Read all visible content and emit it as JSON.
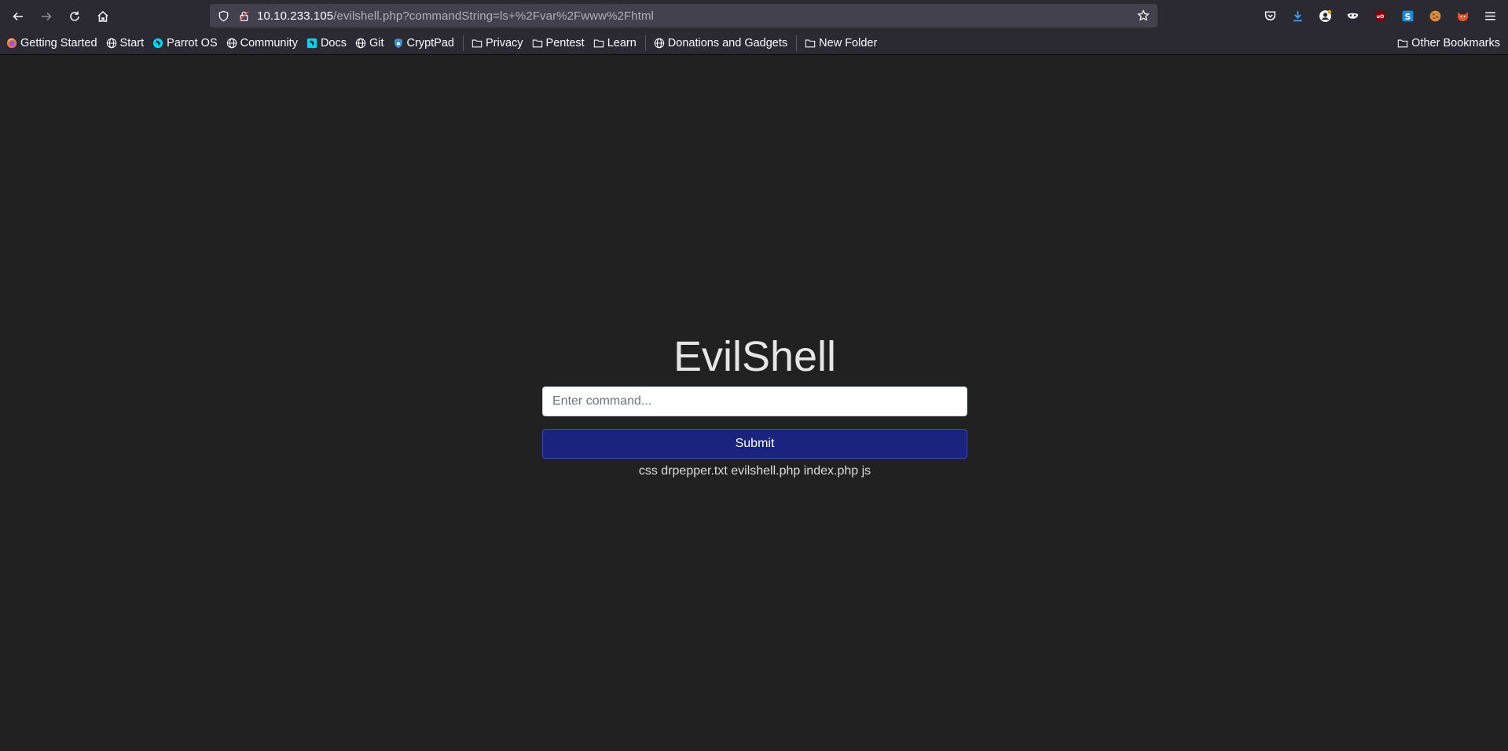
{
  "browser": {
    "url_host": "10.10.233.105",
    "url_path": "/evilshell.php?commandString=ls+%2Fvar%2Fwww%2Fhtml"
  },
  "bookmarks": {
    "items": [
      {
        "label": "Getting Started",
        "icon": "firefox-icon"
      },
      {
        "label": "Start",
        "icon": "globe-icon"
      },
      {
        "label": "Parrot OS",
        "icon": "parrot-icon"
      },
      {
        "label": "Community",
        "icon": "globe-icon"
      },
      {
        "label": "Docs",
        "icon": "parrot-icon"
      },
      {
        "label": "Git",
        "icon": "globe-icon"
      },
      {
        "label": "CryptPad",
        "icon": "shield-icon"
      },
      {
        "label": "Privacy",
        "icon": "folder-icon"
      },
      {
        "label": "Pentest",
        "icon": "folder-icon"
      },
      {
        "label": "Learn",
        "icon": "folder-icon"
      },
      {
        "label": "Donations and Gadgets",
        "icon": "globe-icon"
      },
      {
        "label": "New Folder",
        "icon": "folder-icon"
      }
    ],
    "other": "Other Bookmarks"
  },
  "page": {
    "title": "EvilShell",
    "input_placeholder": "Enter command...",
    "submit_label": "Submit",
    "output": "css drpepper.txt evilshell.php index.php js"
  },
  "colors": {
    "background": "#212121",
    "submit": "#1a237e",
    "toolbar": "#2b2a33"
  }
}
